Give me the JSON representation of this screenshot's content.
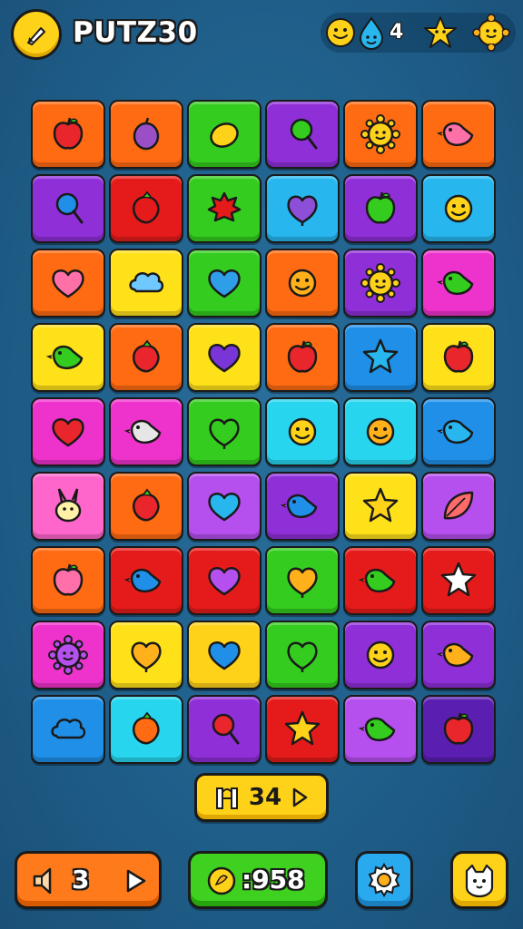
{
  "header": {
    "title": "PUTZ30",
    "lives": "4",
    "colors": {
      "accent": "#ffd21a",
      "outline": "#1a1a1a"
    },
    "icons": [
      "pencil-icon",
      "smiley-icon",
      "water-drop-icon",
      "star-icon",
      "sun-icon"
    ]
  },
  "board": {
    "columns": 6,
    "rows": 9,
    "tiles": [
      {
        "color": "#ff6b12",
        "icon": "apple",
        "fill": "#e8262b"
      },
      {
        "color": "#ff6b12",
        "icon": "plum",
        "fill": "#9b4fc7"
      },
      {
        "color": "#34cc1f",
        "icon": "lemon",
        "fill": "#ffd21a"
      },
      {
        "color": "#8e2fd8",
        "icon": "lollipop",
        "fill": "#34cc1f"
      },
      {
        "color": "#ff6b12",
        "icon": "sun",
        "fill": "#ffd21a"
      },
      {
        "color": "#ff6b12",
        "icon": "bird",
        "fill": "#ff6fa8"
      },
      {
        "color": "#8e2fd8",
        "icon": "lollipop",
        "fill": "#1f8fe8"
      },
      {
        "color": "#e51b1b",
        "icon": "berry",
        "fill": "#e51b1b"
      },
      {
        "color": "#34cc1f",
        "icon": "maple",
        "fill": "#e51b1b"
      },
      {
        "color": "#27b6ee",
        "icon": "heart-blob",
        "fill": "#8e4fd8"
      },
      {
        "color": "#8e2fd8",
        "icon": "apple",
        "fill": "#34cc1f"
      },
      {
        "color": "#27b6ee",
        "icon": "smiley",
        "fill": "#ffd21a"
      },
      {
        "color": "#ff6b12",
        "icon": "heart",
        "fill": "#ff6fa8"
      },
      {
        "color": "#ffe11a",
        "icon": "cloud",
        "fill": "#6fc8ff"
      },
      {
        "color": "#34cc1f",
        "icon": "heart",
        "fill": "#2f9ee8"
      },
      {
        "color": "#ff6b12",
        "icon": "smiley",
        "fill": "#ffb01a"
      },
      {
        "color": "#8e2fd8",
        "icon": "sun",
        "fill": "#ffd21a"
      },
      {
        "color": "#ee33cc",
        "icon": "bird",
        "fill": "#34cc1f"
      },
      {
        "color": "#ffe11a",
        "icon": "bird",
        "fill": "#34cc1f"
      },
      {
        "color": "#ff6b12",
        "icon": "berry",
        "fill": "#e8262b"
      },
      {
        "color": "#ffe11a",
        "icon": "heart",
        "fill": "#7a35d8"
      },
      {
        "color": "#ff6b12",
        "icon": "apple",
        "fill": "#e8262b"
      },
      {
        "color": "#1f8fe8",
        "icon": "star",
        "fill": "#27b6ee"
      },
      {
        "color": "#ffe11a",
        "icon": "apple",
        "fill": "#e8262b"
      },
      {
        "color": "#ee33cc",
        "icon": "heart",
        "fill": "#e8262b"
      },
      {
        "color": "#ee33cc",
        "icon": "bird",
        "fill": "#e6e6e6"
      },
      {
        "color": "#34cc1f",
        "icon": "heart-blob",
        "fill": "#34cc1f"
      },
      {
        "color": "#27d6ee",
        "icon": "smiley",
        "fill": "#ffd21a"
      },
      {
        "color": "#27d6ee",
        "icon": "smiley",
        "fill": "#ffb01a"
      },
      {
        "color": "#1f8fe8",
        "icon": "bird",
        "fill": "#27b6ee"
      },
      {
        "color": "#ff66cc",
        "icon": "bunny",
        "fill": "#fff2a8"
      },
      {
        "color": "#ff6b12",
        "icon": "berry",
        "fill": "#e8262b"
      },
      {
        "color": "#b54fee",
        "icon": "heart",
        "fill": "#27b6ee"
      },
      {
        "color": "#8e2fd8",
        "icon": "bird",
        "fill": "#1f8fe8"
      },
      {
        "color": "#ffe11a",
        "icon": "star",
        "fill": "#ffd21a"
      },
      {
        "color": "#b54fee",
        "icon": "leaf",
        "fill": "#ff6b6b"
      },
      {
        "color": "#ff6b12",
        "icon": "apple",
        "fill": "#ff6fa8"
      },
      {
        "color": "#e51b1b",
        "icon": "bird",
        "fill": "#1f8fe8"
      },
      {
        "color": "#e51b1b",
        "icon": "heart",
        "fill": "#b54fee"
      },
      {
        "color": "#34cc1f",
        "icon": "heart-blob",
        "fill": "#ffb01a"
      },
      {
        "color": "#e51b1b",
        "icon": "bird",
        "fill": "#34cc1f"
      },
      {
        "color": "#e51b1b",
        "icon": "star",
        "fill": "#ffffff"
      },
      {
        "color": "#ee33cc",
        "icon": "sun",
        "fill": "#b54fee"
      },
      {
        "color": "#ffe11a",
        "icon": "heart-blob",
        "fill": "#ffb01a"
      },
      {
        "color": "#ffd21a",
        "icon": "heart",
        "fill": "#1f8fe8"
      },
      {
        "color": "#34cc1f",
        "icon": "heart-blob",
        "fill": "#34cc1f"
      },
      {
        "color": "#8e2fd8",
        "icon": "smiley",
        "fill": "#ffd21a"
      },
      {
        "color": "#8e2fd8",
        "icon": "bird",
        "fill": "#ffb01a"
      },
      {
        "color": "#1f8fe8",
        "icon": "cloud",
        "fill": "#1f8fe8"
      },
      {
        "color": "#27d6ee",
        "icon": "berry",
        "fill": "#ff6b12"
      },
      {
        "color": "#8e2fd8",
        "icon": "lollipop",
        "fill": "#e8262b"
      },
      {
        "color": "#e51b1b",
        "icon": "star",
        "fill": "#ffd21a"
      },
      {
        "color": "#b54fee",
        "icon": "bird",
        "fill": "#34cc1f"
      },
      {
        "color": "#5a1fb0",
        "icon": "apple",
        "fill": "#e8262b"
      }
    ]
  },
  "mid_button": {
    "label": "34",
    "icons": [
      "gate-icon",
      "play-icon"
    ]
  },
  "bottom": {
    "sound_label": "3",
    "coins_label": ":958",
    "icons": [
      "speaker-icon",
      "play-icon",
      "coin-icon",
      "gear-icon",
      "pet-face-icon"
    ]
  }
}
